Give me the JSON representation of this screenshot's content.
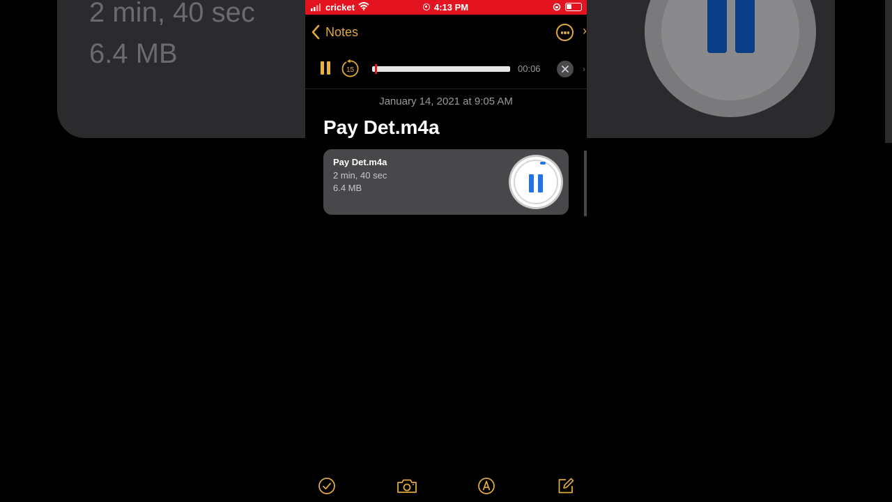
{
  "background_zoom": {
    "duration": "2 min, 40 sec",
    "size": "6.4 MB"
  },
  "status_bar": {
    "carrier": "cricket",
    "time": "4:13 PM",
    "bar_color": "#e3141f"
  },
  "nav": {
    "back_label": "Notes",
    "accent_color": "#e1a93a"
  },
  "player": {
    "elapsed": "00:06",
    "skip_seconds": "15",
    "progress_fraction": 0.04
  },
  "note": {
    "date": "January 14, 2021 at 9:05 AM",
    "title": "Pay Det.m4a"
  },
  "attachment": {
    "name": "Pay Det.m4a",
    "duration": "2 min, 40 sec",
    "size": "6.4 MB",
    "play_color": "#2473e6"
  },
  "toolbar": {
    "items": [
      "checklist-icon",
      "camera-icon",
      "markup-icon",
      "compose-icon"
    ]
  }
}
